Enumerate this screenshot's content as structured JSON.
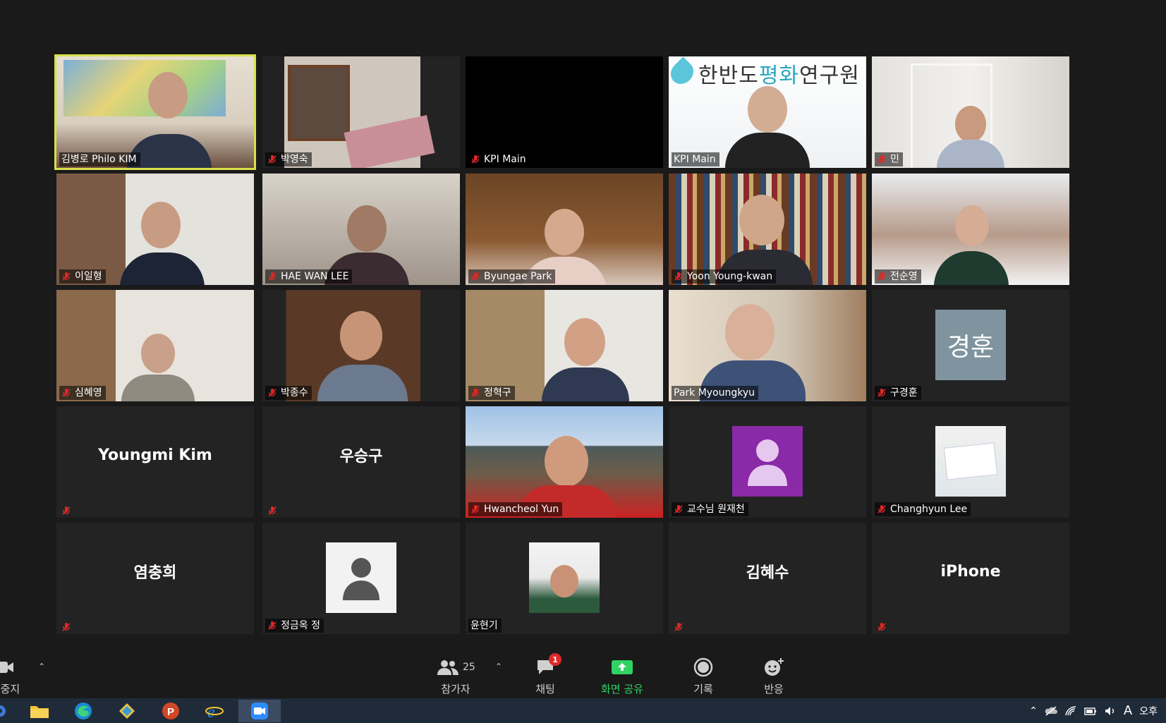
{
  "participants": [
    {
      "name": "김병로 Philo KIM",
      "muted": false
    },
    {
      "name": "박영숙",
      "muted": true
    },
    {
      "name": "KPI Main",
      "muted": true
    },
    {
      "name": "KPI Main",
      "muted": false,
      "logo_main": "한반도",
      "logo_accent": "평화",
      "logo_tail": "연구원"
    },
    {
      "name": "민",
      "muted": true
    },
    {
      "name": "이일형",
      "muted": true
    },
    {
      "name": "HAE WAN LEE",
      "muted": true
    },
    {
      "name": "Byungae Park",
      "muted": true
    },
    {
      "name": "Yoon Young-kwan",
      "muted": true
    },
    {
      "name": "전순영",
      "muted": true
    },
    {
      "name": "심혜영",
      "muted": true
    },
    {
      "name": "박종수",
      "muted": true
    },
    {
      "name": "정혁구",
      "muted": true
    },
    {
      "name": "Park Myoungkyu",
      "muted": false
    },
    {
      "name": "구경훈",
      "muted": true,
      "initials": "경훈"
    },
    {
      "name": "Youngmi Kim",
      "muted": true
    },
    {
      "name": "우승구",
      "muted": true
    },
    {
      "name": "Hwancheol Yun",
      "muted": true
    },
    {
      "name": "교수님 원재천",
      "muted": true
    },
    {
      "name": "Changhyun Lee",
      "muted": true
    },
    {
      "name": "염충희",
      "muted": true
    },
    {
      "name": "정금옥 정",
      "muted": true
    },
    {
      "name": "윤현기",
      "muted": false
    },
    {
      "name": "김혜수",
      "muted": true
    },
    {
      "name": "iPhone",
      "muted": true
    }
  ],
  "toolbar": {
    "video_label": "오 중지",
    "participants_label": "참가자",
    "participants_count": "25",
    "chat_label": "채팅",
    "chat_badge": "1",
    "share_label": "화면 공유",
    "record_label": "기록",
    "reactions_label": "반응"
  },
  "taskbar": {
    "clock": "오후"
  },
  "colors": {
    "active_speaker": "#d8e04a",
    "share_green": "#2fd363",
    "muted_red": "#e02828"
  }
}
